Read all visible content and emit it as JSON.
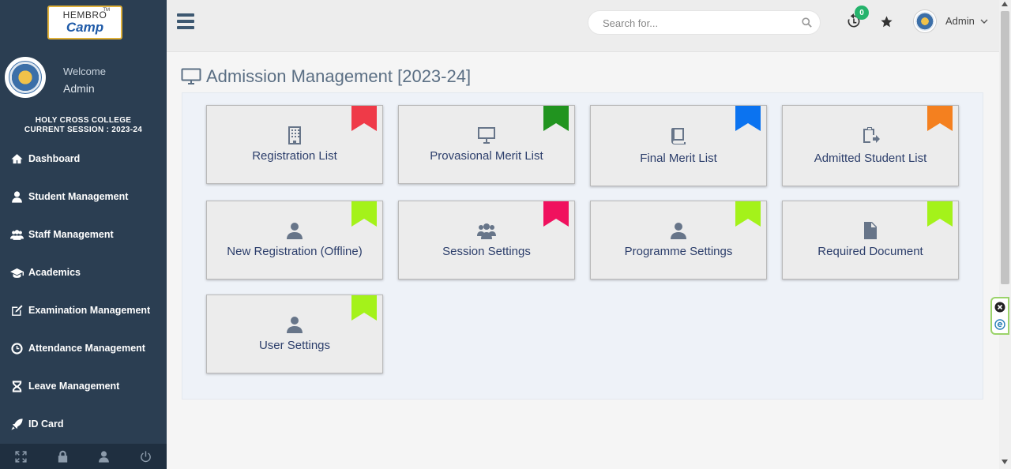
{
  "sidebar": {
    "logo_top": "HEMBRO",
    "logo_bottom": "Camp",
    "logo_tm": "TM",
    "welcome": "Welcome",
    "user": "Admin",
    "college_line1": "HOLY CROSS COLLEGE",
    "college_line2": "CURRENT SESSION : 2023-24",
    "items": [
      {
        "label": "Dashboard",
        "icon": "home-icon"
      },
      {
        "label": "Student Management",
        "icon": "user-icon"
      },
      {
        "label": "Staff Management",
        "icon": "users-icon"
      },
      {
        "label": "Academics",
        "icon": "graduation-cap-icon"
      },
      {
        "label": "Examination Management",
        "icon": "edit-icon"
      },
      {
        "label": "Attendance Management",
        "icon": "clock-icon"
      },
      {
        "label": "Leave Management",
        "icon": "hourglass-icon"
      },
      {
        "label": "ID Card",
        "icon": "rocket-icon"
      }
    ],
    "footer_icons": [
      "fullscreen-icon",
      "lock-icon",
      "profile-icon",
      "power-icon"
    ]
  },
  "header": {
    "search_placeholder": "Search for...",
    "notification_count": "0",
    "user_name": "Admin"
  },
  "main": {
    "title": "Admission Management [2023-24]",
    "cards": [
      {
        "label": "Registration List",
        "icon": "building-icon",
        "ribbon": "#ef3a48"
      },
      {
        "label": "Provasional Merit List",
        "icon": "desktop-icon",
        "ribbon": "#21941f"
      },
      {
        "label": "Final Merit List",
        "icon": "book-icon",
        "ribbon": "#0b73f0"
      },
      {
        "label": "Admitted Student List",
        "icon": "clipboard-icon",
        "ribbon": "#f4801f"
      },
      {
        "label": "New Registration (Offline)",
        "icon": "user-icon",
        "ribbon": "#a4f21a"
      },
      {
        "label": "Session Settings",
        "icon": "users-icon",
        "ribbon": "#f0115e"
      },
      {
        "label": "Programme Settings",
        "icon": "user-icon",
        "ribbon": "#a4f21a"
      },
      {
        "label": "Required Document",
        "icon": "file-icon",
        "ribbon": "#a4f21a"
      },
      {
        "label": "User Settings",
        "icon": "user-icon",
        "ribbon": "#a4f21a"
      }
    ]
  },
  "colors": {
    "sidebar_bg": "#2b3e52",
    "accent_text": "#2c3e6b",
    "badge_green": "#25b36c"
  }
}
